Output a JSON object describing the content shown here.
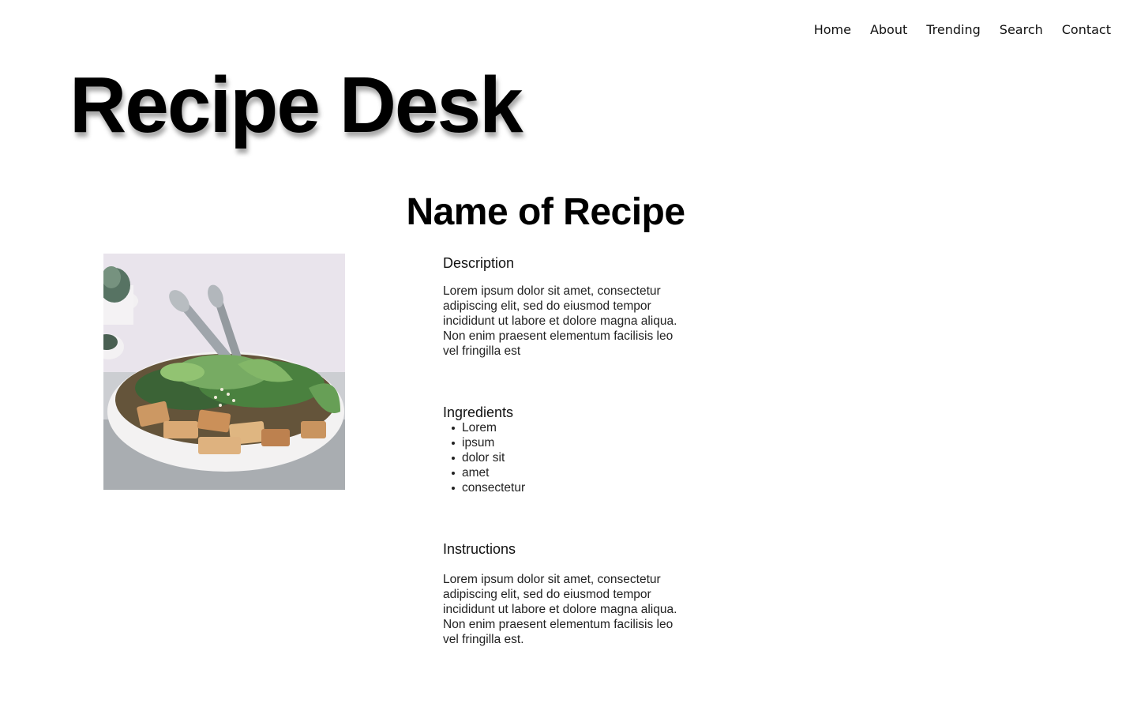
{
  "nav": {
    "items": [
      {
        "label": "Home"
      },
      {
        "label": "About"
      },
      {
        "label": "Trending"
      },
      {
        "label": "Search"
      },
      {
        "label": "Contact"
      }
    ]
  },
  "site": {
    "title": "Recipe Desk"
  },
  "recipe": {
    "title": "Name of Recipe",
    "description_heading": "Description",
    "description": "Lorem ipsum dolor sit amet, consectetur adipiscing elit, sed do eiusmod tempor incididunt ut labore et dolore magna aliqua. Non enim praesent elementum facilisis leo vel fringilla est",
    "ingredients_heading": "Ingredients",
    "ingredients": [
      "Lorem",
      "ipsum",
      "dolor sit",
      "amet",
      "consectetur"
    ],
    "instructions_heading": "Instructions",
    "instructions": "Lorem ipsum dolor sit amet, consectetur adipiscing elit, sed do eiusmod tempor incididunt ut labore et dolore magna aliqua. Non enim praesent elementum facilisis leo vel fringilla est."
  },
  "colors": {
    "background": "#ffffff",
    "text": "#000000",
    "image_backdrop": "#e9e4ec"
  }
}
